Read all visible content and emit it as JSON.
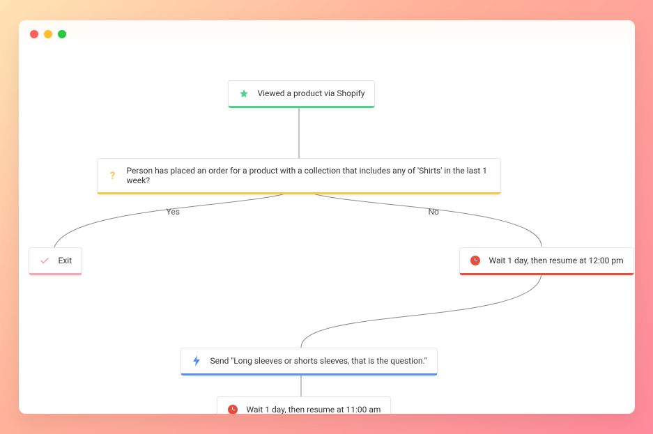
{
  "nodes": {
    "trigger": {
      "label": "Viewed a product via Shopify"
    },
    "condition": {
      "label": "Person has placed an order for a product with a collection that includes any of 'Shirts' in the last 1 week?"
    },
    "exit": {
      "label": "Exit"
    },
    "wait1": {
      "label": "Wait 1 day, then resume at 12:00 pm"
    },
    "send": {
      "label": "Send \"Long sleeves or shorts sleeves, that is the question.\""
    },
    "wait2": {
      "label": "Wait 1 day, then resume at 11:00 am"
    }
  },
  "branches": {
    "yes": "Yes",
    "no": "No"
  }
}
